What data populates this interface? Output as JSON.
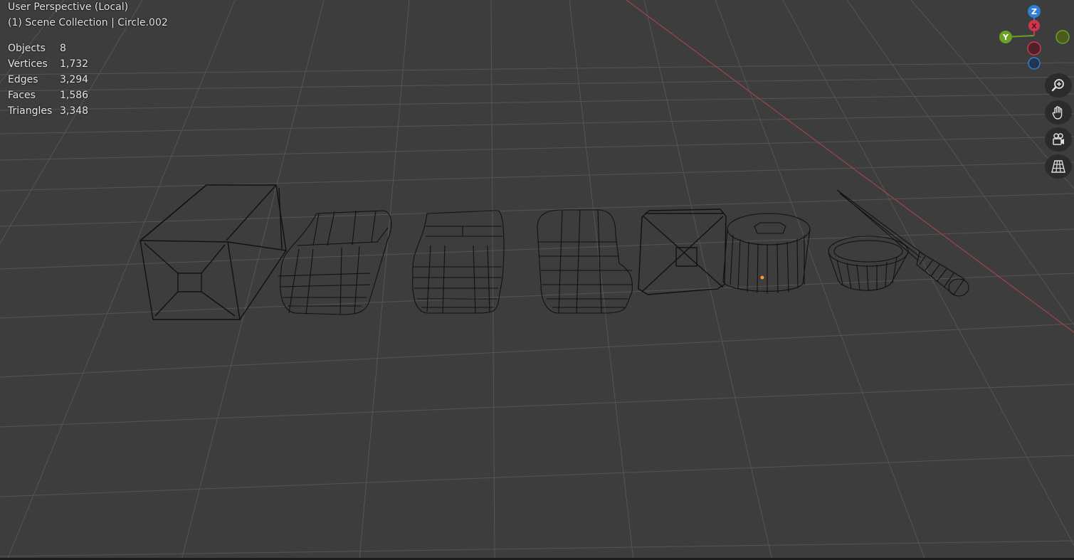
{
  "viewport": {
    "view_name": "User Perspective (Local)",
    "collection_info": "(1) Scene Collection | Circle.002"
  },
  "stats": [
    {
      "label": "Objects",
      "value": "8"
    },
    {
      "label": "Vertices",
      "value": "1,732"
    },
    {
      "label": "Edges",
      "value": "3,294"
    },
    {
      "label": "Faces",
      "value": "1,586"
    },
    {
      "label": "Triangles",
      "value": "3,348"
    }
  ],
  "gizmo": {
    "z_label": "Z",
    "y_label": "Y",
    "x_label": "X",
    "x_color": "#d0374f",
    "y_color": "#6aa125",
    "z_color": "#2f7fd6"
  },
  "tools": [
    "zoom-icon",
    "pan-hand-icon",
    "camera-view-icon",
    "grid-perspective-icon"
  ],
  "colors": {
    "background": "#3d3d3d",
    "grid": "#545454",
    "x_axis": "#a4424a",
    "wire": "#0e0e0e"
  }
}
